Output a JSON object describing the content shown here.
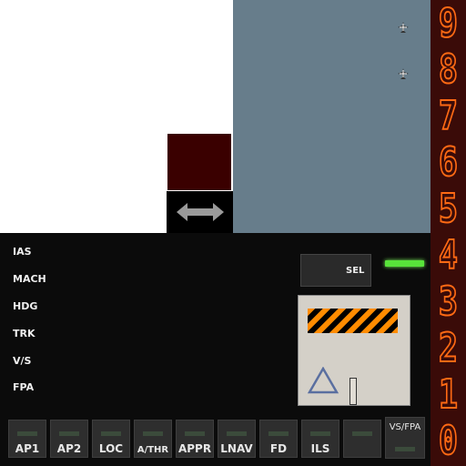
{
  "map": {
    "traffic": [
      "aircraft-icon",
      "aircraft-icon"
    ]
  },
  "altitude_digits": [
    "9",
    "8",
    "7",
    "6",
    "5",
    "4",
    "3",
    "2",
    "1",
    "0"
  ],
  "modes": [
    "IAS",
    "MACH",
    "HDG",
    "TRK",
    "V/S",
    "FPA"
  ],
  "sel_button": {
    "label": "SEL"
  },
  "ap_buttons": [
    {
      "label": "AP1"
    },
    {
      "label": "AP2"
    },
    {
      "label": "LOC"
    },
    {
      "label": "A/THR"
    },
    {
      "label": "APPR"
    },
    {
      "label": "LNAV"
    },
    {
      "label": "FD"
    },
    {
      "label": "ILS"
    },
    {
      "label": ""
    }
  ],
  "vs_fpa_button": {
    "label": "VS/FPA"
  },
  "colors": {
    "digit": "#ff6a14",
    "indicator_on": "#58e33a",
    "map": "#677d8b"
  }
}
